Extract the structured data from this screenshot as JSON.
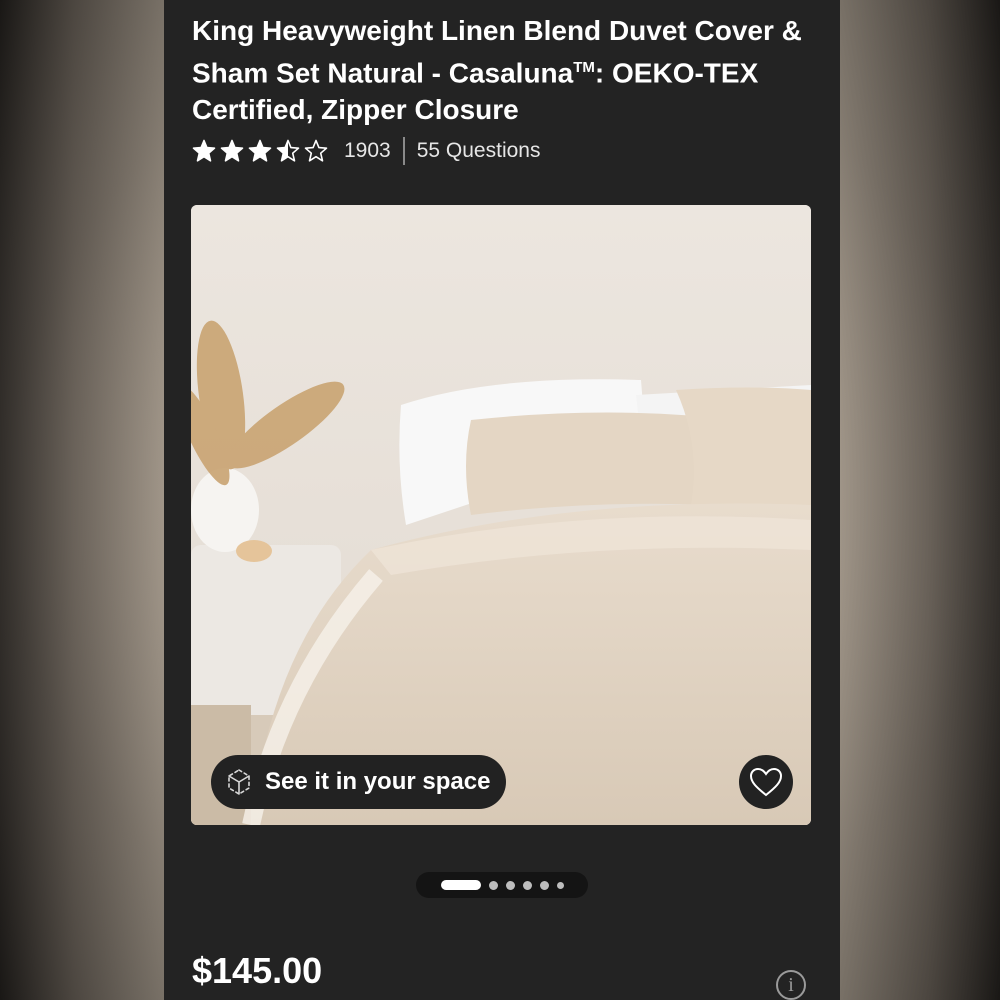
{
  "product": {
    "title_main": "King Heavyweight Linen Blend Duvet Cover & Sham Set Natural - Casaluna",
    "trademark": "TM",
    "title_colon": ":",
    "title_rest": " OEKO-TEX Certified, Zipper Closure"
  },
  "rating": {
    "stars": 3.5,
    "max_stars": 5,
    "review_count": "1903",
    "questions_label": "55 Questions"
  },
  "gallery": {
    "ar_button_label": "See it in your space",
    "image_count": 6,
    "active_index": 0
  },
  "icons": {
    "star": "star-icon",
    "ar": "cube-3d-icon",
    "favorite": "heart-icon",
    "info": "info-icon"
  },
  "pricing": {
    "price": "$145.00",
    "info_glyph": "i"
  },
  "colors": {
    "background": "#232323",
    "text": "#ffffff",
    "pill": "#222222"
  }
}
